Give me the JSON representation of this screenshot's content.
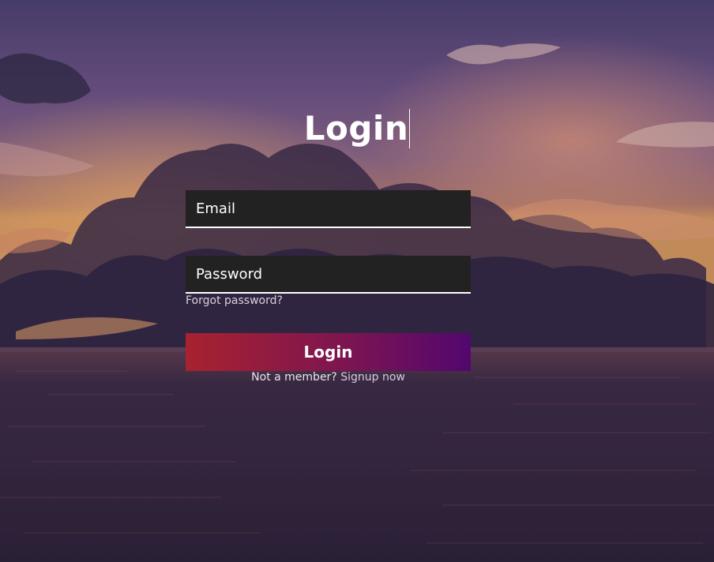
{
  "heading": "Login",
  "email": {
    "placeholder": "Email",
    "value": ""
  },
  "password": {
    "placeholder": "Password",
    "value": ""
  },
  "forgot_password": "Forgot password?",
  "submit_label": "Login",
  "signup": {
    "prompt": "Not a member?",
    "link": "Signup now"
  },
  "colors": {
    "button_gradient_start": "#a8222f",
    "button_gradient_end": "#52076e",
    "field_background": "#222222",
    "text": "#ffffff"
  }
}
